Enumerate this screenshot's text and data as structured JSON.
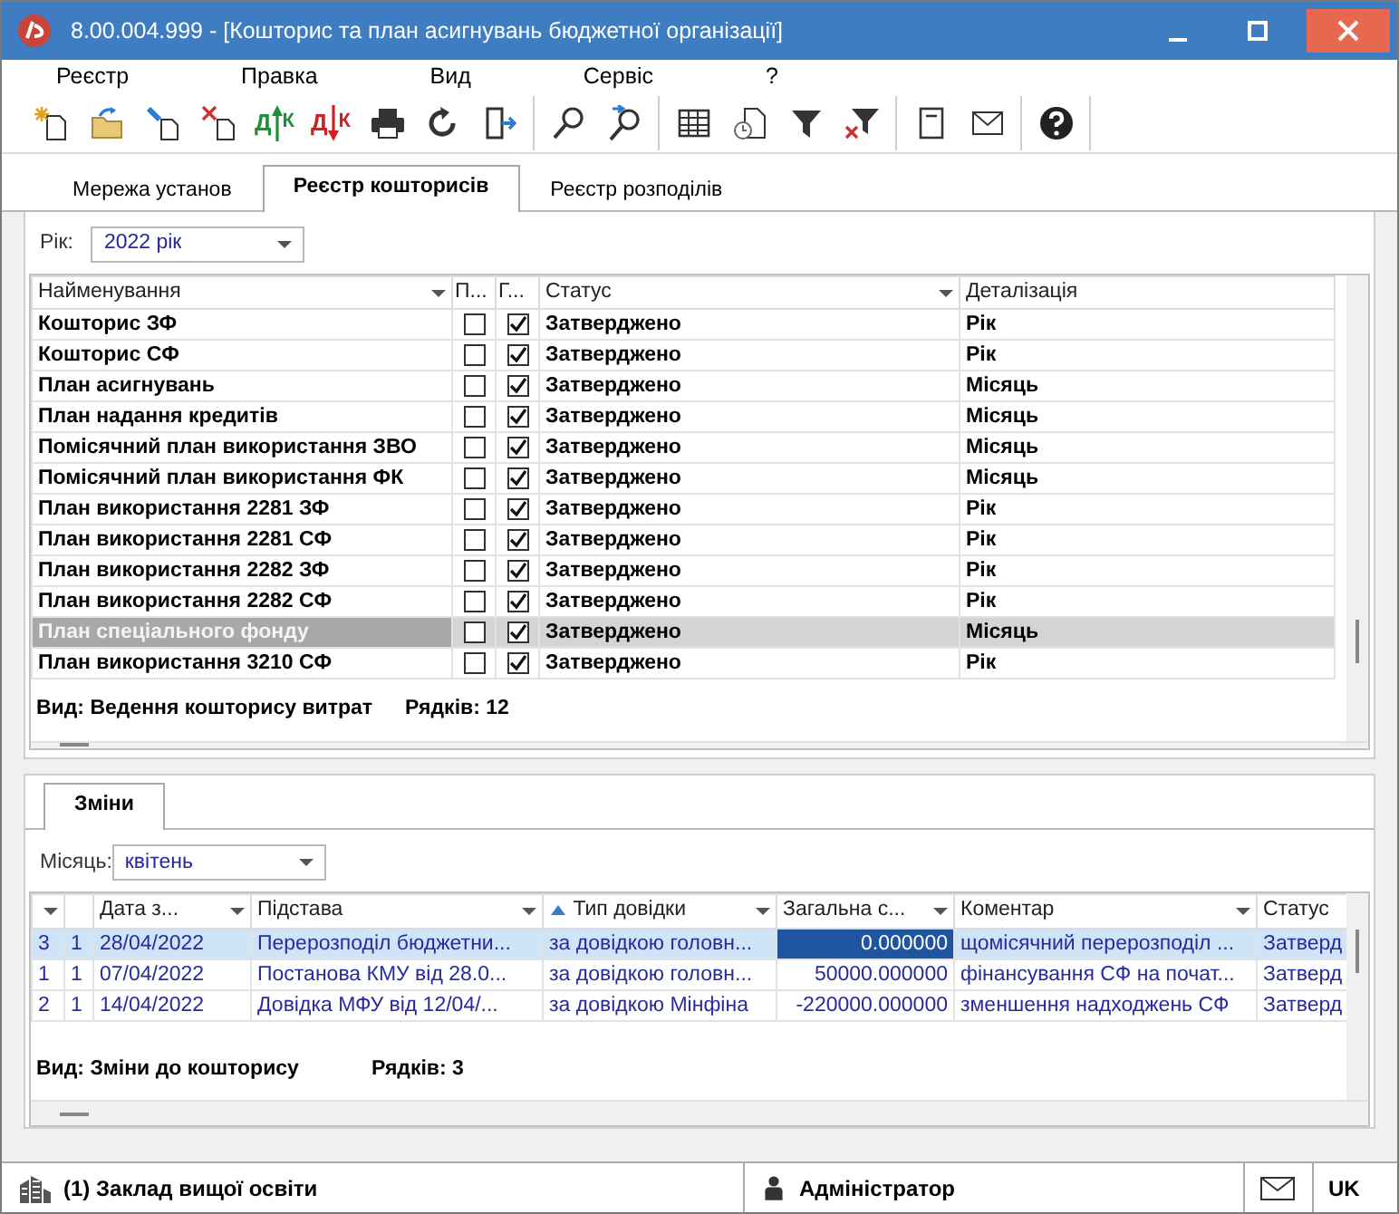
{
  "window": {
    "title": "8.00.004.999 - [Кошторис та план асигнувань бюджетної організації]"
  },
  "menu": [
    "Реєстр",
    "Правка",
    "Вид",
    "Сервіс",
    "?"
  ],
  "toolbar": [
    [
      {
        "kind": "new"
      },
      {
        "kind": "open"
      },
      {
        "kind": "edit"
      },
      {
        "kind": "delete"
      },
      {
        "kind": "dk-up",
        "left": "Д",
        "right": "К"
      },
      {
        "kind": "dk-down",
        "left": "Д",
        "right": "К"
      },
      {
        "kind": "print"
      },
      {
        "kind": "refresh"
      },
      {
        "kind": "exit"
      }
    ],
    [
      {
        "kind": "find"
      },
      {
        "kind": "find-next"
      }
    ],
    [
      {
        "kind": "grid"
      },
      {
        "kind": "history"
      },
      {
        "kind": "filter"
      },
      {
        "kind": "filter-clear"
      }
    ],
    [
      {
        "kind": "notepad"
      },
      {
        "kind": "mail"
      }
    ],
    [
      {
        "kind": "help"
      }
    ]
  ],
  "tabs": [
    {
      "label": "Мережа установ",
      "selected": false
    },
    {
      "label": "Реєстр кошторисів",
      "selected": true
    },
    {
      "label": "Реєстр розподілів",
      "selected": false
    }
  ],
  "year": {
    "label": "Рік:",
    "value": "2022 рік"
  },
  "estimates": {
    "columns": [
      {
        "label": "Найменування",
        "filter_arrow": true
      },
      {
        "label": "П...",
        "filter_arrow": false
      },
      {
        "label": "Г...",
        "filter_arrow": false
      },
      {
        "label": "Статус",
        "filter_arrow": true
      },
      {
        "label": "Деталізація",
        "filter_arrow": false
      }
    ],
    "rows": [
      {
        "name": "Кошторис ЗФ",
        "p": false,
        "g": true,
        "status": "Затверджено",
        "detail": "Рік",
        "selected": false
      },
      {
        "name": "Кошторис СФ",
        "p": false,
        "g": true,
        "status": "Затверджено",
        "detail": "Рік",
        "selected": false
      },
      {
        "name": "План асигнувань",
        "p": false,
        "g": true,
        "status": "Затверджено",
        "detail": "Місяць",
        "selected": false
      },
      {
        "name": "План надання кредитів",
        "p": false,
        "g": true,
        "status": "Затверджено",
        "detail": "Місяць",
        "selected": false
      },
      {
        "name": "Помісячний план використання ЗВО",
        "p": false,
        "g": true,
        "status": "Затверджено",
        "detail": "Місяць",
        "selected": false
      },
      {
        "name": "Помісячний план використання ФК",
        "p": false,
        "g": true,
        "status": "Затверджено",
        "detail": "Місяць",
        "selected": false
      },
      {
        "name": "План використання 2281 ЗФ",
        "p": false,
        "g": true,
        "status": "Затверджено",
        "detail": "Рік",
        "selected": false
      },
      {
        "name": "План використання 2281 СФ",
        "p": false,
        "g": true,
        "status": "Затверджено",
        "detail": "Рік",
        "selected": false
      },
      {
        "name": "План використання 2282 ЗФ",
        "p": false,
        "g": true,
        "status": "Затверджено",
        "detail": "Рік",
        "selected": false
      },
      {
        "name": "План використання 2282 СФ",
        "p": false,
        "g": true,
        "status": "Затверджено",
        "detail": "Рік",
        "selected": false
      },
      {
        "name": "План спеціального фонду",
        "p": false,
        "g": true,
        "status": "Затверджено",
        "detail": "Місяць",
        "selected": true
      },
      {
        "name": "План використання 3210 СФ",
        "p": false,
        "g": true,
        "status": "Затверджено",
        "detail": "Рік",
        "selected": false
      }
    ],
    "view": "Вид: Ведення кошторису витрат",
    "count": "Рядків: 12"
  },
  "lower_tabs": [
    {
      "label": "Зміни",
      "selected": true
    }
  ],
  "month": {
    "label": "Місяць:",
    "value": "квітень"
  },
  "changes": {
    "columns": [
      {
        "filter_arrow": true,
        "sorted": false
      },
      {
        "filter_arrow": false,
        "sorted": false
      },
      {
        "label": "Дата з...",
        "filter_arrow": true,
        "sorted": false
      },
      {
        "label": "Підстава",
        "filter_arrow": true,
        "sorted": false
      },
      {
        "label": "Тип довідки",
        "filter_arrow": true,
        "sorted": true
      },
      {
        "label": "Загальна с...",
        "filter_arrow": true,
        "sorted": false
      },
      {
        "label": "Коментар",
        "filter_arrow": true,
        "sorted": false
      },
      {
        "label": "Статус",
        "filter_arrow": false,
        "sorted": false
      }
    ],
    "rows": [
      {
        "cells": [
          "3",
          "1",
          "28/04/2022",
          "Перерозподіл бюджетни...",
          "за довідкою головн...",
          "0.000000",
          "щомісячний перерозподіл ...",
          "Затверд"
        ],
        "selected": true
      },
      {
        "cells": [
          "1",
          "1",
          "07/04/2022",
          "Постанова КМУ від 28.0...",
          "за довідкою головн...",
          "50000.000000",
          "фінансування СФ на почат...",
          "Затверд"
        ],
        "selected": false
      },
      {
        "cells": [
          "2",
          "1",
          "14/04/2022",
          "Довідка МФУ від 12/04/...",
          "за довідкою Мінфіна",
          "-220000.000000",
          "зменшення надходжень СФ",
          "Затверд"
        ],
        "selected": false
      }
    ],
    "view": "Вид: Зміни до кошторису",
    "count": "Рядків: 3"
  },
  "status_bar": {
    "organization": "(1) Заклад вищої освіти",
    "user": "Адміністратор",
    "language": "UK"
  }
}
